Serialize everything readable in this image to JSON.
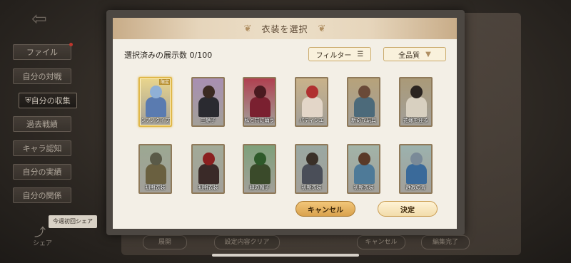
{
  "sidebar": {
    "items": [
      {
        "label": "ファイル",
        "badge": true
      },
      {
        "label": "自分の対戦",
        "badge": false
      },
      {
        "label": "自分の収集",
        "badge": false,
        "active": true
      },
      {
        "label": "過去戦績",
        "badge": false
      },
      {
        "label": "キャラ認知",
        "badge": false
      },
      {
        "label": "自分の実績",
        "badge": false
      },
      {
        "label": "自分の関係",
        "badge": false
      }
    ]
  },
  "share": {
    "tip": "今週初回シェア",
    "label": "シェア"
  },
  "background_buttons": [
    "展開",
    "設定内容クリア",
    "キャンセル",
    "編集完了"
  ],
  "modal": {
    "title": "衣装を選択",
    "count_text": "選択済みの展示数 0/100",
    "filter_label": "フィルター",
    "quality_label": "全品質",
    "cancel_label": "キャンセル",
    "confirm_label": "決定"
  },
  "cards": [
    {
      "name": "シアノタイプ",
      "badge": "限定",
      "bg": "#e9d58c",
      "head": "#8fb0d6",
      "body": "#5a7bb0"
    },
    {
      "name": "三静子",
      "bg": "#a88fb2",
      "head": "#3b2a22",
      "body": "#2a2a30"
    },
    {
      "name": "私と共に踊う",
      "bg": "#b04050",
      "head": "#4a1a20",
      "body": "#7a2030"
    },
    {
      "name": "パティシエ",
      "bg": "#c9b28a",
      "head": "#b03030",
      "body": "#e3d6c8"
    },
    {
      "name": "新奇な玩具",
      "bg": "#b7a27a",
      "head": "#6a4a38",
      "body": "#4c6a7a"
    },
    {
      "name": "花嫁を迎る",
      "bg": "#aa9a78",
      "head": "#2a2420",
      "body": "#d8d0c0"
    },
    {
      "name": "初期衣装",
      "bg": "#9ca892",
      "head": "#5a5a48",
      "body": "#6a6040"
    },
    {
      "name": "初期衣装",
      "bg": "#a2aa98",
      "head": "#8a2020",
      "body": "#3a2a28"
    },
    {
      "name": "緑の帽子",
      "bg": "#7ea07a",
      "head": "#2e5a2a",
      "body": "#3a4a2a"
    },
    {
      "name": "初期衣装",
      "bg": "#9aa8a2",
      "head": "#3a3028",
      "body": "#4a4e58"
    },
    {
      "name": "初期衣装",
      "bg": "#a2b4a8",
      "head": "#5a3a28",
      "body": "#4e7a98"
    },
    {
      "name": "静寂の青",
      "bg": "#9cb2ae",
      "head": "#7a8a98",
      "body": "#3a6a9a"
    }
  ],
  "colors": {
    "accent": "#c9a96a",
    "modal_bg": "#f3efe6",
    "header": "#e6d5bb"
  },
  "icons": {
    "back": "back-arrow-icon",
    "filter": "list-icon",
    "dropdown": "chevron-down-icon",
    "leaf": "leaf-ornament-icon",
    "share": "share-icon",
    "shield": "shield-icon"
  }
}
